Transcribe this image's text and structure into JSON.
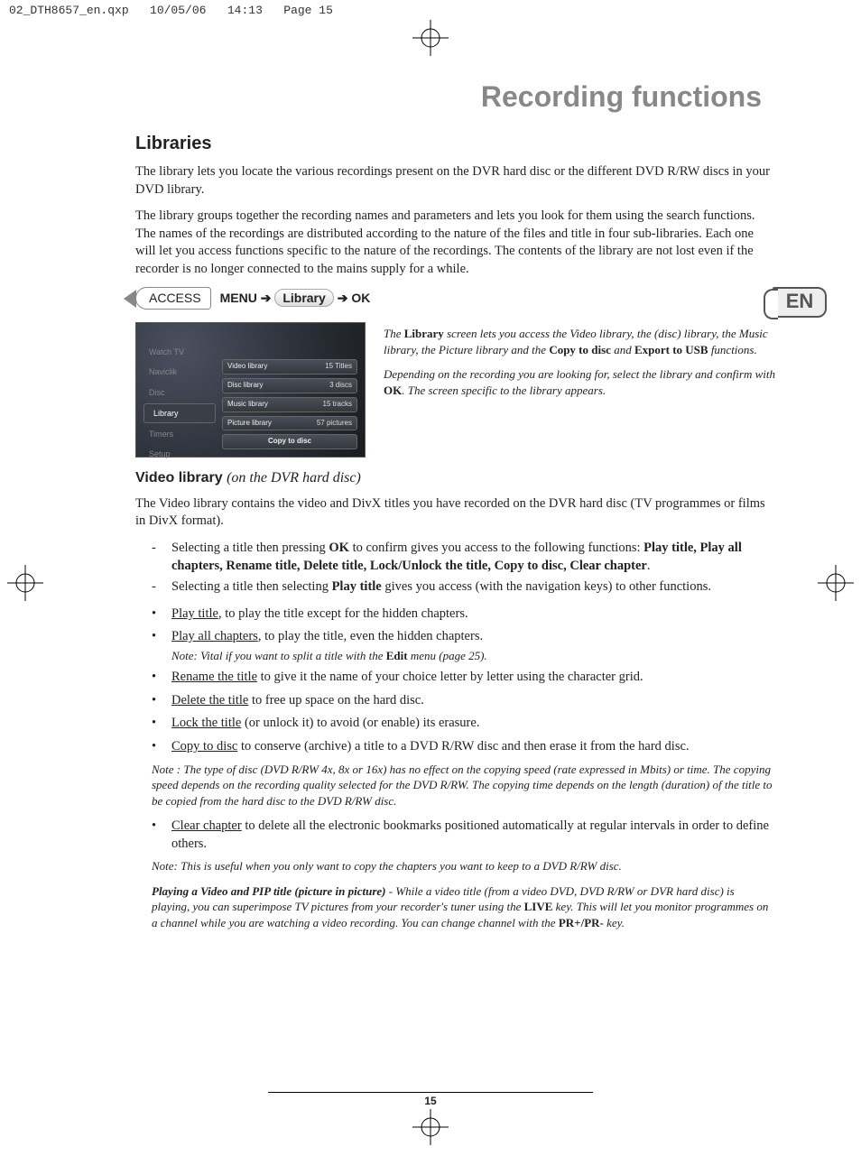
{
  "header": {
    "filename": "02_DTH8657_en.qxp",
    "date": "10/05/06",
    "time": "14:13",
    "pagelabel": "Page 15"
  },
  "page_title": "Recording functions",
  "lang_badge": "EN",
  "h2": "Libraries",
  "para1": "The library lets you locate the various recordings present on the DVR hard disc or the different DVD R/RW discs in your DVD library.",
  "para2": "The library groups together the recording names and parameters and lets you look for them using the search functions. The names of the recordings are distributed according to the nature of the files and title in four sub-libraries. Each one will let you access functions specific to the nature of the recordings. The contents of the library are not lost even if the recorder is no longer connected to the mains supply for a while.",
  "access_label": "ACCESS",
  "breadcrumb": {
    "menu": "MENU",
    "arrow": "➔",
    "library": "Library",
    "ok": "OK"
  },
  "screenshot": {
    "left_menu": [
      "Watch TV",
      "Naviclik",
      "Disc",
      "Library",
      "Timers",
      "Setup"
    ],
    "left_active_index": 3,
    "rows": [
      {
        "name": "Video library",
        "count": "15 Titles"
      },
      {
        "name": "Disc library",
        "count": "3 discs"
      },
      {
        "name": "Music library",
        "count": "15 tracks"
      },
      {
        "name": "Picture library",
        "count": "57 pictures"
      }
    ],
    "copy_btn": "Copy to disc"
  },
  "side": {
    "p1a": "The ",
    "p1b": "Library",
    "p1c": " screen lets you access the Video library, the (disc) library, the Music library, the Picture library and the ",
    "p1d": "Copy to disc",
    "p1e": " and ",
    "p1f": "Export to USB",
    "p1g": " functions.",
    "p2a": "Depending on the recording you are looking for, select the library and confirm with ",
    "p2b": "OK",
    "p2c": ". The screen specific to the library appears."
  },
  "h3_main": "Video library",
  "h3_paren": "(on the DVR hard disc)",
  "vl_para": "The Video library contains the video and DivX titles you have recorded on the DVR hard disc (TV programmes or films in DivX format).",
  "dash1a": "Selecting a title then pressing ",
  "dash1b": "OK",
  "dash1c": " to confirm gives you access to the following functions: ",
  "dash1_bold": "Play title, Play all chapters, Rename title, Delete title, Lock/Unlock the title, Copy to disc, Clear chapter",
  "dash1d": ".",
  "dash2a": "Selecting a title then selecting ",
  "dash2b": "Play title",
  "dash2c": " gives you access (with the navigation keys) to other functions.",
  "dot1_u": "Play title",
  "dot1_r": ", to play the title except for the hidden chapters.",
  "dot2_u": "Play all chapters",
  "dot2_r": ", to play the title, even the hidden chapters.",
  "note1a": "Note: Vital if you want to split a title with the ",
  "note1b": "Edit",
  "note1c": " menu (page 25).",
  "dot3_u": "Rename the title",
  "dot3_r": " to give it the name of your choice letter by letter using the character grid.",
  "dot4_u": "Delete the title",
  "dot4_r": " to free up space on the hard disc.",
  "dot5_u": "Lock the title",
  "dot5_r": " (or unlock it) to avoid (or enable) its erasure.",
  "dot6_u": "Copy to disc",
  "dot6_r": " to conserve (archive) a title to a DVD R/RW disc and then erase it from the hard disc.",
  "note2": "Note : The type of disc (DVD R/RW 4x, 8x or 16x) has no effect on the copying speed (rate expressed in Mbits) or time. The copying speed depends on the recording quality selected for the DVD R/RW. The copying time depends on the length (duration) of the title to be copied from the hard disc to the DVD R/RW disc.",
  "dot7_u": "Clear chapter",
  "dot7_r": " to delete all the electronic bookmarks positioned automatically at regular intervals in order to define others.",
  "note3": "Note: This is useful when you only want to copy the chapters you want to keep to a DVD R/RW disc.",
  "pip_bold": "Playing a Video and PIP title (picture in picture)",
  "pip_a": " - While a video title (from a video DVD, DVD R/RW or DVR hard disc) is playing, you can superimpose TV pictures from your recorder's tuner using the ",
  "pip_b": "LIVE",
  "pip_c": " key. This will let you monitor programmes on a channel while you are watching a video recording. You can change channel with the ",
  "pip_d": "PR+/PR-",
  "pip_e": " key.",
  "page_num": "15"
}
